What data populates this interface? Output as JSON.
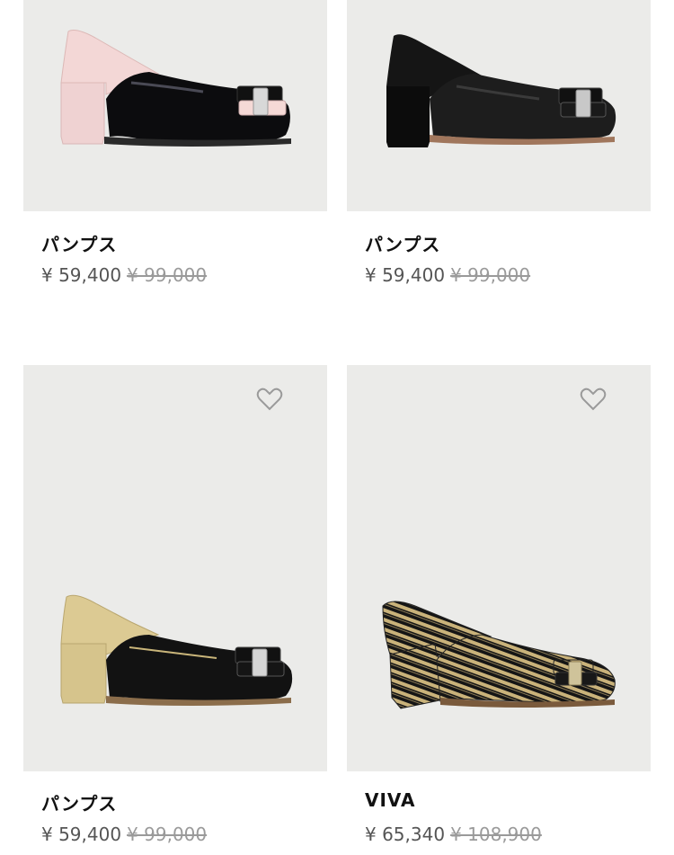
{
  "products": [
    {
      "name": "パンプス",
      "sale_price": "¥ 59,400",
      "original_price": "¥ 99,000",
      "image": "pink-black-patent-pump"
    },
    {
      "name": "パンプス",
      "sale_price": "¥ 59,400",
      "original_price": "¥ 99,000",
      "image": "black-suede-pump"
    },
    {
      "name": "パンプス",
      "sale_price": "¥ 59,400",
      "original_price": "¥ 99,000",
      "image": "gold-black-suede-pump",
      "icon": "heart-icon"
    },
    {
      "name": "VIVA",
      "sale_price": "¥ 65,340",
      "original_price": "¥ 108,900",
      "image": "black-gold-striped-pump",
      "icon": "heart-icon"
    }
  ],
  "colors": {
    "image_bg": "#ebebe9",
    "text": "#111111",
    "price": "#555555",
    "strike": "#9a9a9a",
    "heart": "#9a9a9a"
  }
}
